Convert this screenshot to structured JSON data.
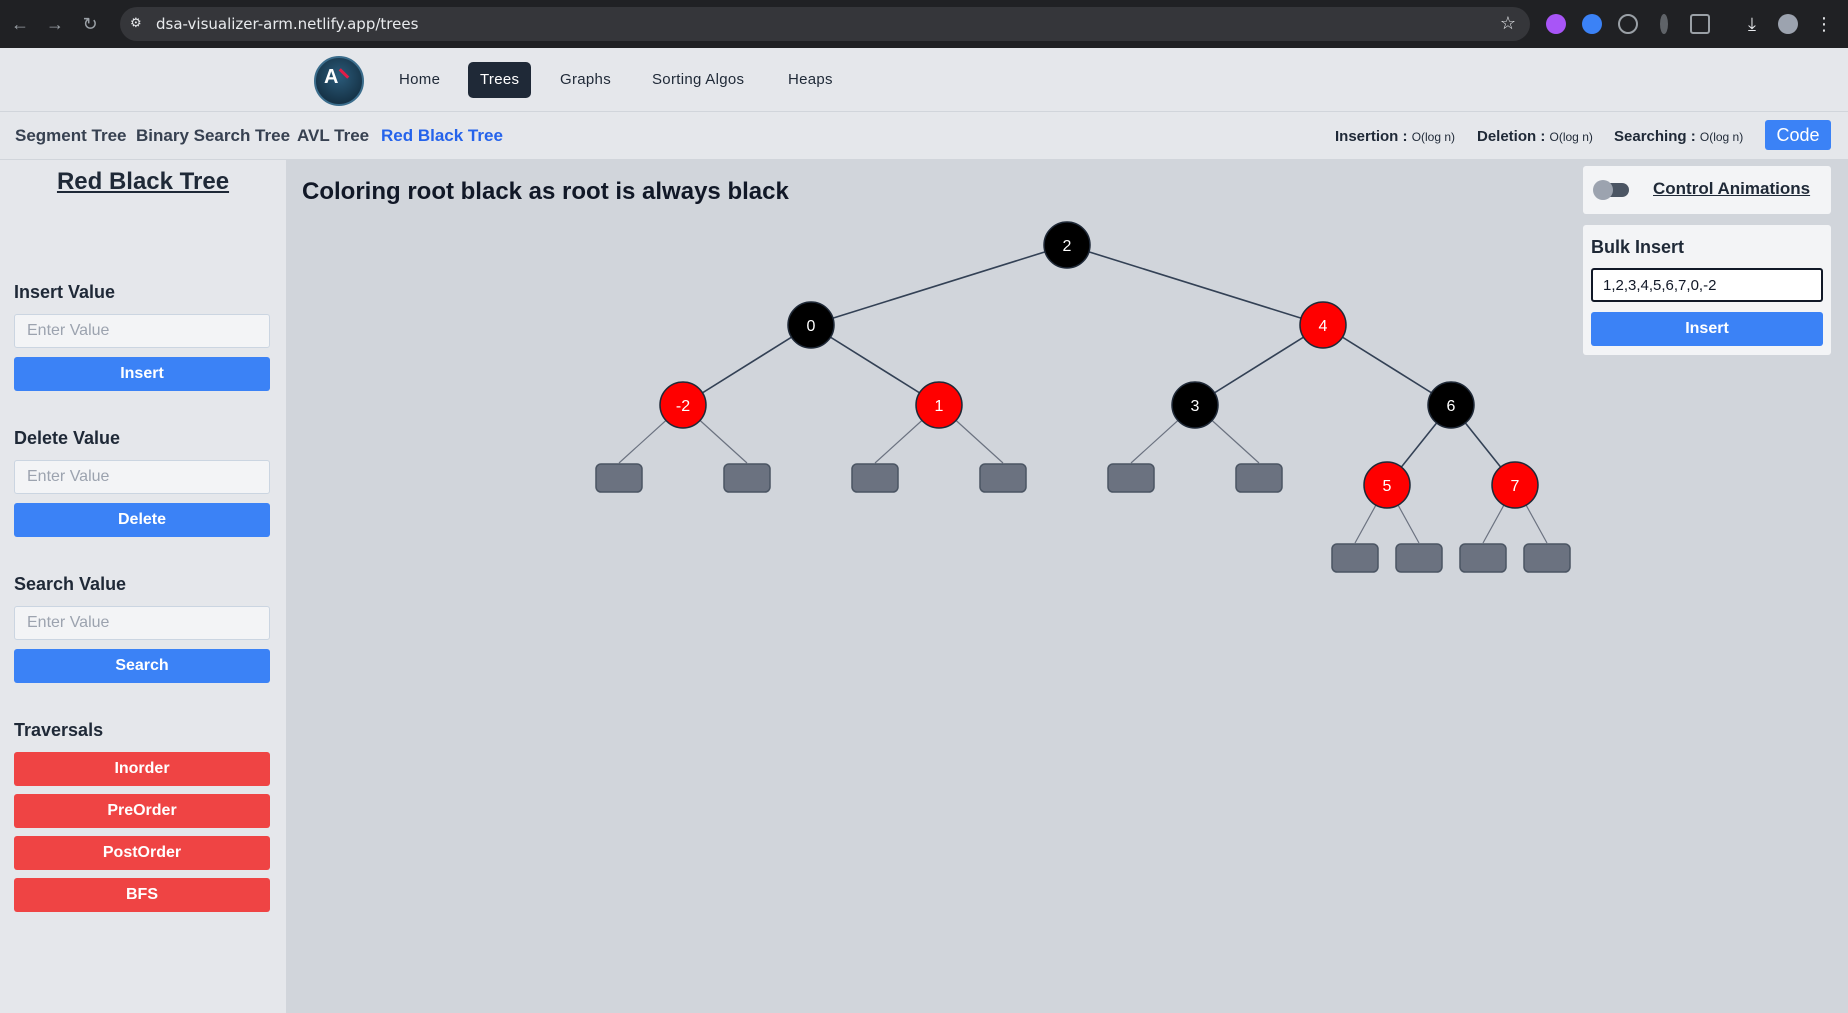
{
  "browser": {
    "url": "dsa-visualizer-arm.netlify.app/trees"
  },
  "nav": {
    "items": [
      {
        "label": "Home",
        "active": false
      },
      {
        "label": "Trees",
        "active": true
      },
      {
        "label": "Graphs",
        "active": false
      },
      {
        "label": "Sorting Algos",
        "active": false
      },
      {
        "label": "Heaps",
        "active": false
      }
    ]
  },
  "subnav": {
    "items": [
      {
        "label": "Segment Tree",
        "active": false
      },
      {
        "label": "Binary Search Tree",
        "active": false
      },
      {
        "label": "AVL Tree",
        "active": false
      },
      {
        "label": "Red Black Tree",
        "active": true
      }
    ],
    "complexity": {
      "insertion_label": "Insertion :",
      "insertion_value": "O(log n)",
      "deletion_label": "Deletion :",
      "deletion_value": "O(log n)",
      "searching_label": "Searching :",
      "searching_value": "O(log n)"
    },
    "code_label": "Code"
  },
  "sidebar": {
    "title": "Red Black Tree",
    "insert": {
      "label": "Insert Value",
      "placeholder": "Enter Value",
      "button": "Insert"
    },
    "delete": {
      "label": "Delete Value",
      "placeholder": "Enter Value",
      "button": "Delete"
    },
    "search": {
      "label": "Search Value",
      "placeholder": "Enter Value",
      "button": "Search"
    },
    "traversals": {
      "label": "Traversals",
      "buttons": [
        "Inorder",
        "PreOrder",
        "PostOrder",
        "BFS"
      ]
    }
  },
  "main": {
    "status": "Coloring root black as root is always black"
  },
  "animations": {
    "label": "Control Animations",
    "enabled": false
  },
  "bulk": {
    "label": "Bulk Insert",
    "value": "1,2,3,4,5,6,7,0,-2",
    "button": "Insert"
  },
  "colors": {
    "red": "#ff0000",
    "black": "#000000",
    "nil": "#6b7280",
    "accent": "#3b82f6",
    "danger": "#ef4444"
  },
  "tree": {
    "value": "2",
    "color": "black",
    "left": {
      "value": "0",
      "color": "black",
      "left": {
        "value": "-2",
        "color": "red",
        "left": null,
        "right": null
      },
      "right": {
        "value": "1",
        "color": "red",
        "left": null,
        "right": null
      }
    },
    "right": {
      "value": "4",
      "color": "red",
      "left": {
        "value": "3",
        "color": "black",
        "left": null,
        "right": null
      },
      "right": {
        "value": "6",
        "color": "black",
        "left": {
          "value": "5",
          "color": "red",
          "left": null,
          "right": null
        },
        "right": {
          "value": "7",
          "color": "red",
          "left": null,
          "right": null
        }
      }
    }
  }
}
